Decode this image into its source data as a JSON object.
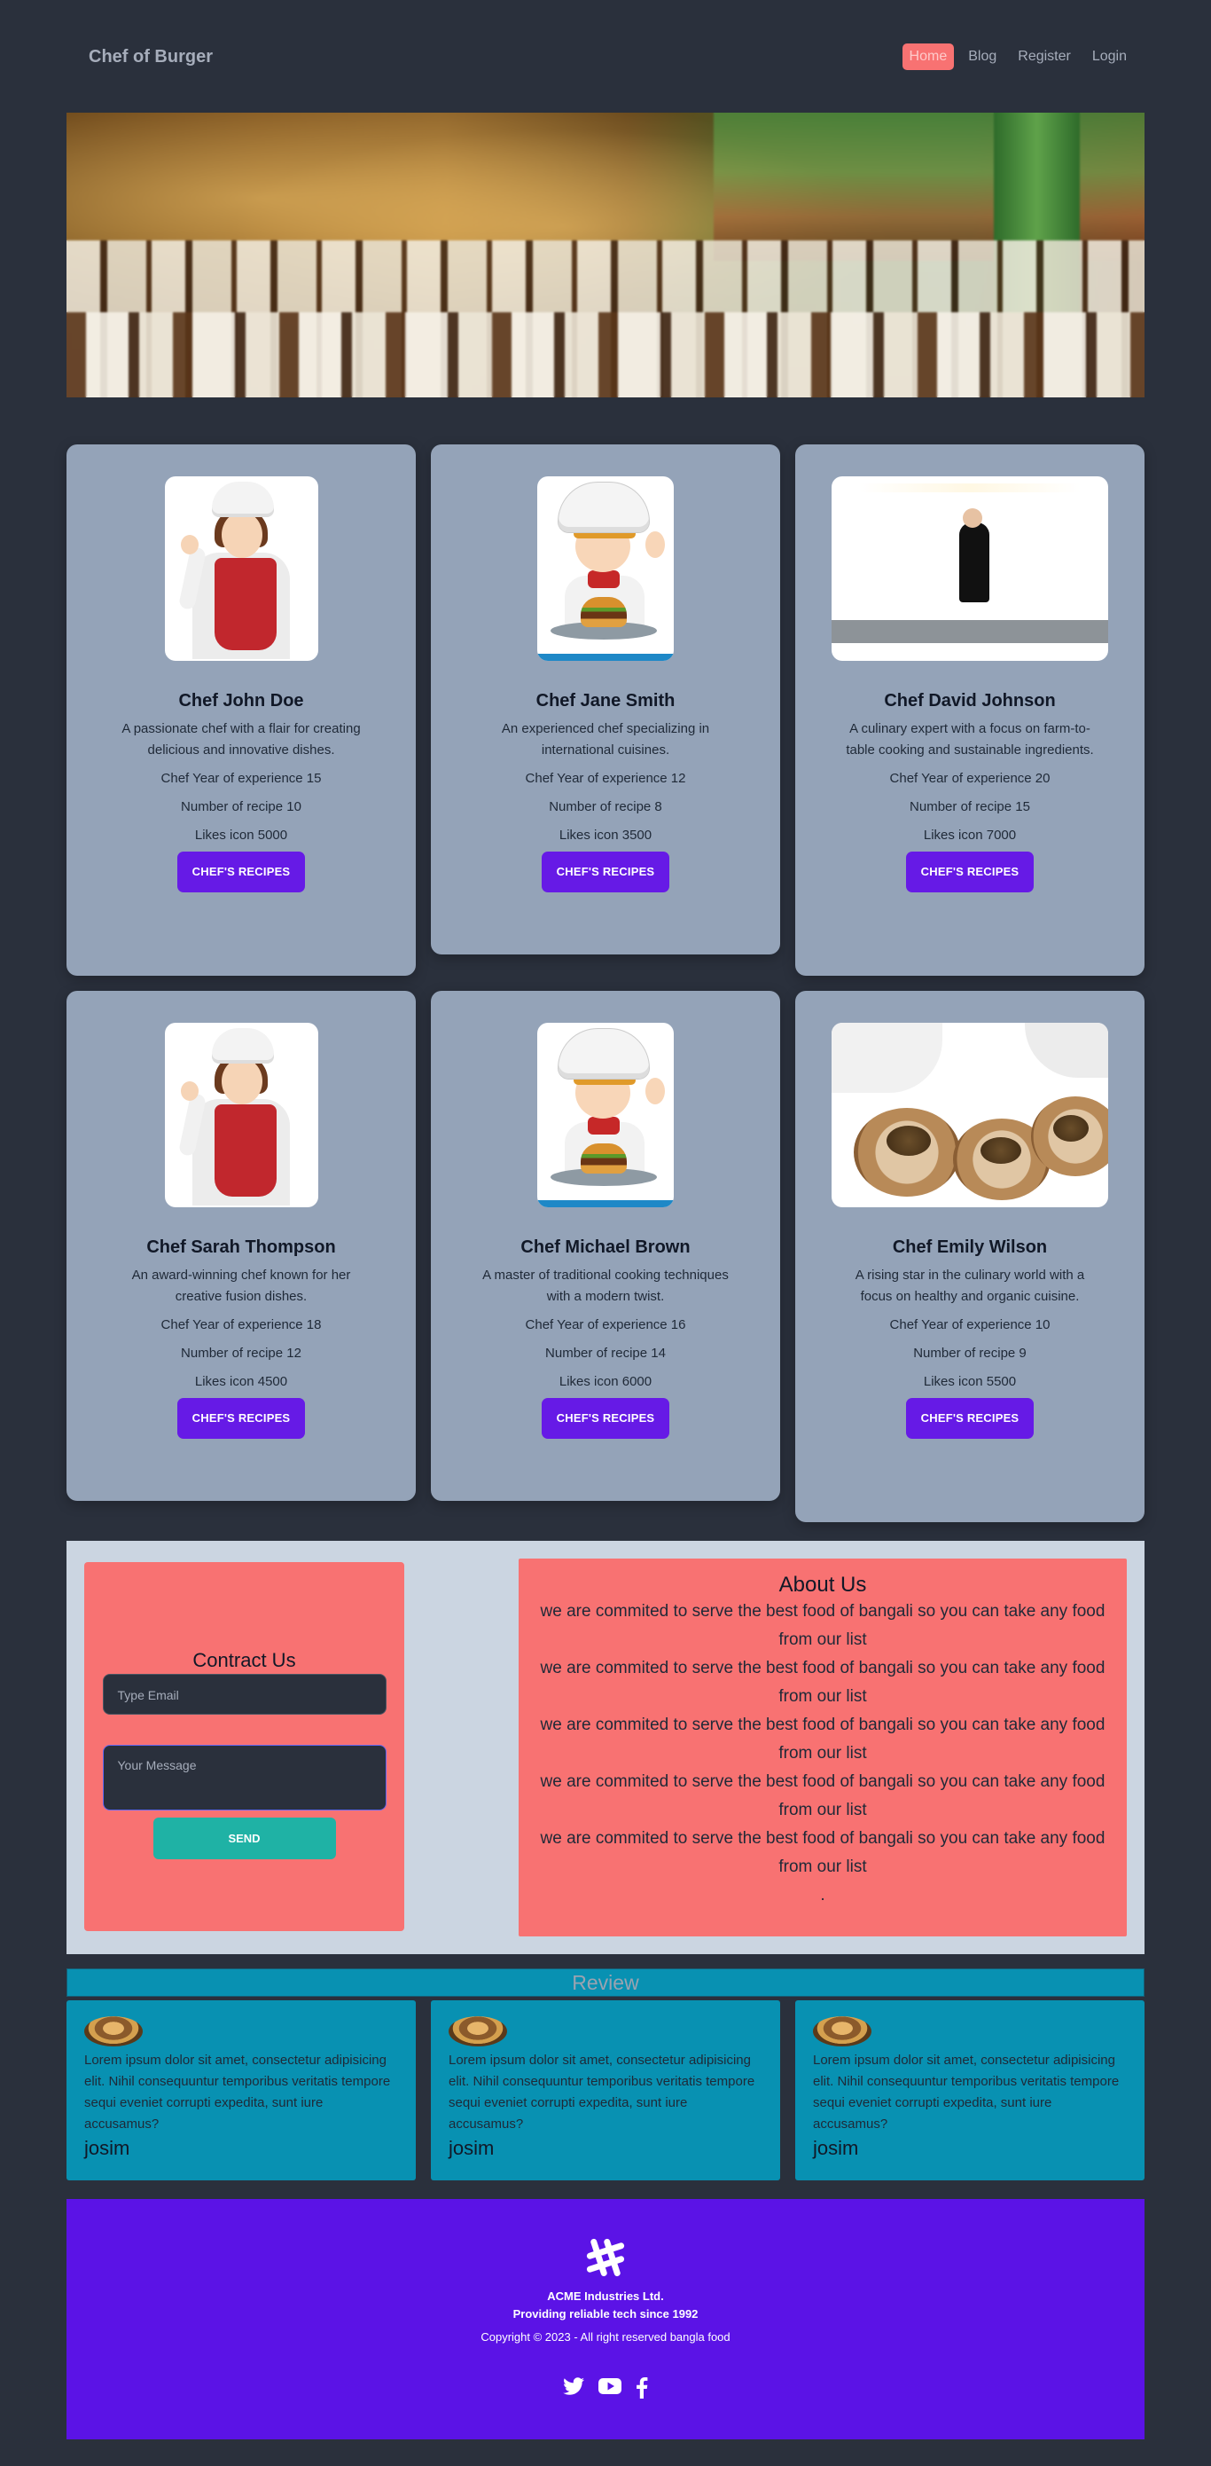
{
  "nav": {
    "brand": "Chef of Burger",
    "links": [
      "Home",
      "Blog",
      "Register",
      "Login"
    ]
  },
  "chefs": [
    {
      "name": "Chef John Doe",
      "desc": "A passionate chef with a flair for creating delicious and innovative dishes.",
      "experience": "Chef Year of experience 15",
      "recipes": "Number of recipe 10",
      "likes": "Likes icon 5000",
      "button": "CHEF'S RECIPES",
      "image": "chef-woman-illustration"
    },
    {
      "name": "Chef Jane Smith",
      "desc": "An experienced chef specializing in international cuisines.",
      "experience": "Chef Year of experience 12",
      "recipes": "Number of recipe 8",
      "likes": "Likes icon 3500",
      "button": "CHEF'S RECIPES",
      "image": "chef-burger-illustration"
    },
    {
      "name": "Chef David Johnson",
      "desc": "A culinary expert with a focus on farm-to-table cooking and sustainable ingredients.",
      "experience": "Chef Year of experience 20",
      "recipes": "Number of recipe 15",
      "likes": "Likes icon 7000",
      "button": "CHEF'S RECIPES",
      "image": "kitchen-photo"
    },
    {
      "name": "Chef Sarah Thompson",
      "desc": "An award-winning chef known for her creative fusion dishes.",
      "experience": "Chef Year of experience 18",
      "recipes": "Number of recipe 12",
      "likes": "Likes icon 4500",
      "button": "CHEF'S RECIPES",
      "image": "chef-woman-illustration"
    },
    {
      "name": "Chef Michael Brown",
      "desc": "A master of traditional cooking techniques with a modern twist.",
      "experience": "Chef Year of experience 16",
      "recipes": "Number of recipe 14",
      "likes": "Likes icon 6000",
      "button": "CHEF'S RECIPES",
      "image": "chef-burger-illustration"
    },
    {
      "name": "Chef Emily Wilson",
      "desc": "A rising star in the culinary world with a focus on healthy and organic cuisine.",
      "experience": "Chef Year of experience 10",
      "recipes": "Number of recipe 9",
      "likes": "Likes icon 5500",
      "button": "CHEF'S RECIPES",
      "image": "plating-photo"
    }
  ],
  "contact": {
    "title": "Contract Us",
    "email_placeholder": "Type Email",
    "message_placeholder": "Your Message",
    "send": "SEND"
  },
  "about": {
    "title": "About Us",
    "paragraphs": [
      "we are commited to serve the best food of bangali so you can take any food from our list",
      "we are commited to serve the best food of bangali so you can take any food from our list",
      "we are commited to serve the best food of bangali so you can take any food from our list",
      "we are commited to serve the best food of bangali so you can take any food from our list",
      "we are commited to serve the best food of bangali so you can take any food from our list"
    ],
    "trailer": "."
  },
  "review": {
    "title": "Review",
    "items": [
      {
        "text": "Lorem ipsum dolor sit amet, consectetur adipisicing elit. Nihil consequuntur temporibus veritatis tempore sequi eveniet corrupti expedita, sunt iure accusamus?",
        "name": "josim"
      },
      {
        "text": "Lorem ipsum dolor sit amet, consectetur adipisicing elit. Nihil consequuntur temporibus veritatis tempore sequi eveniet corrupti expedita, sunt iure accusamus?",
        "name": "josim"
      },
      {
        "text": "Lorem ipsum dolor sit amet, consectetur adipisicing elit. Nihil consequuntur temporibus veritatis tempore sequi eveniet corrupti expedita, sunt iure accusamus?",
        "name": "josim"
      }
    ]
  },
  "footer": {
    "company": "ACME Industries Ltd.",
    "tagline": "Providing reliable tech since 1992",
    "copyright": "Copyright © 2023 - All right reserved bangla food",
    "socials": [
      "twitter-icon",
      "youtube-icon",
      "facebook-icon"
    ]
  },
  "colors": {
    "background": "#2a303c",
    "accent": "#661ae6",
    "active_nav": "#f87272",
    "card": "#94a3b8",
    "review": "#0891b2",
    "send": "#1fb2a5"
  }
}
